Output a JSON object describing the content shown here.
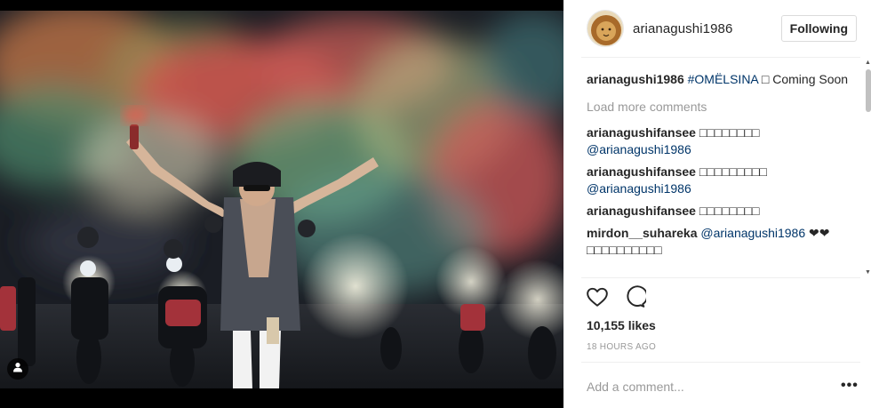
{
  "post": {
    "username": "arianagushi1986",
    "follow_label": "Following",
    "caption": {
      "user": "arianagushi1986",
      "hashtag": "#OMËLSINA",
      "text": "□ Coming Soon"
    },
    "load_more_label": "Load more comments",
    "comments": [
      {
        "user": "arianagushifansee",
        "text": "□□□□□□□□",
        "mention": "@arianagushi1986"
      },
      {
        "user": "arianagushifansee",
        "text": "□□□□□□□□□",
        "mention": "@arianagushi1986"
      },
      {
        "user": "arianagushifansee",
        "text": "□□□□□□□□",
        "mention": ""
      },
      {
        "user": "mirdon__suhareka",
        "mention": "@arianagushi1986",
        "text": "❤❤ □□□□□□□□□□"
      }
    ],
    "likes": "10,155 likes",
    "timestamp": "18 HOURS AGO",
    "comment_placeholder": "Add a comment...",
    "more_glyph": "•••"
  },
  "icons": {
    "heart": "heart-icon",
    "comment": "comment-icon",
    "user_tag": "user-tag-icon",
    "avatar": "lion-avatar"
  },
  "colors": {
    "link": "#003569",
    "muted": "#999999",
    "text": "#262626",
    "border": "#dbdbdb"
  }
}
